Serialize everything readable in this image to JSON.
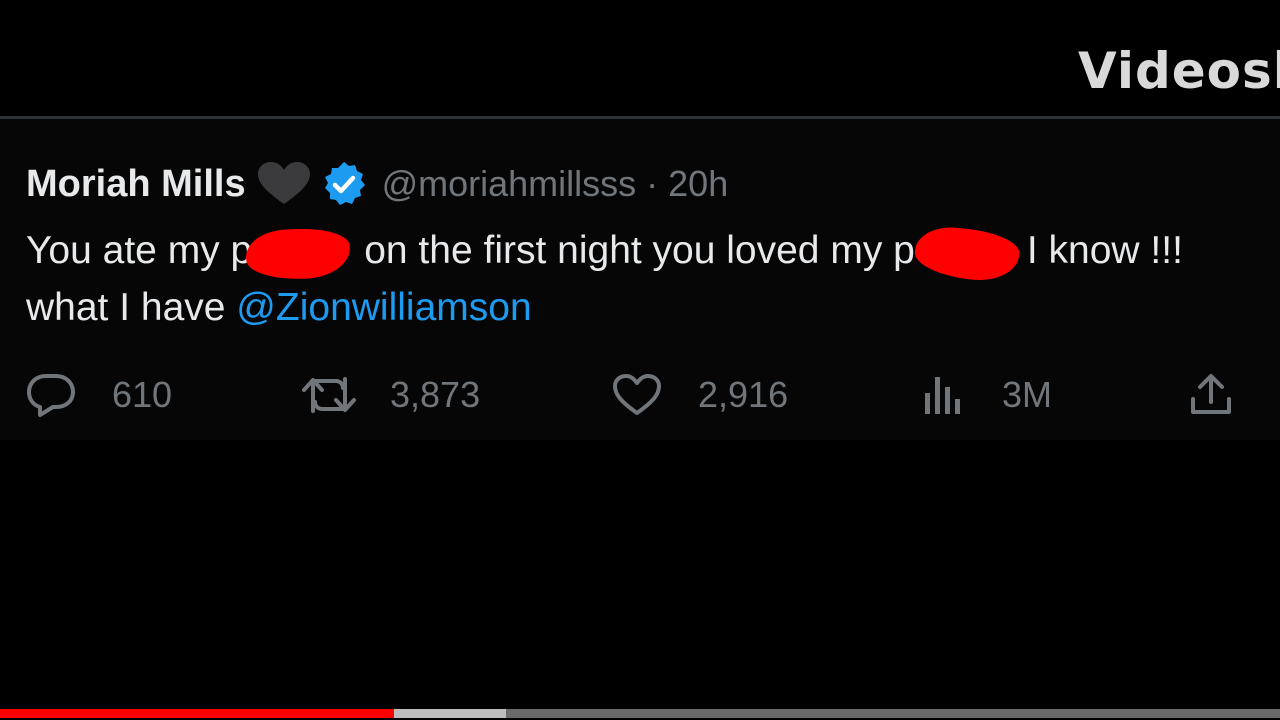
{
  "watermark": "Videosh",
  "tweet": {
    "author_name": "Moriah Mills",
    "handle": "@moriahmillsss",
    "separator": "·",
    "time_ago": "20h",
    "badges": {
      "heart_color": "#3b3b3d",
      "verified_color": "#1d9bf0"
    },
    "text": {
      "line1_part1": "You ate my p",
      "line1_part2": "on the first night you loved my p",
      "line1_part3": "I know !!!",
      "line2_part1": "what I have ",
      "mention": "@Zionwilliamson"
    },
    "redaction_color": "#ff0000",
    "actions": {
      "replies": "610",
      "reposts": "3,873",
      "likes": "2,916",
      "views": "3M"
    },
    "mention_color": "#1d9bf0"
  },
  "video_progress": {
    "played_fraction": 0.308,
    "buffered_fraction": 0.395,
    "played_color": "#ff0000"
  }
}
